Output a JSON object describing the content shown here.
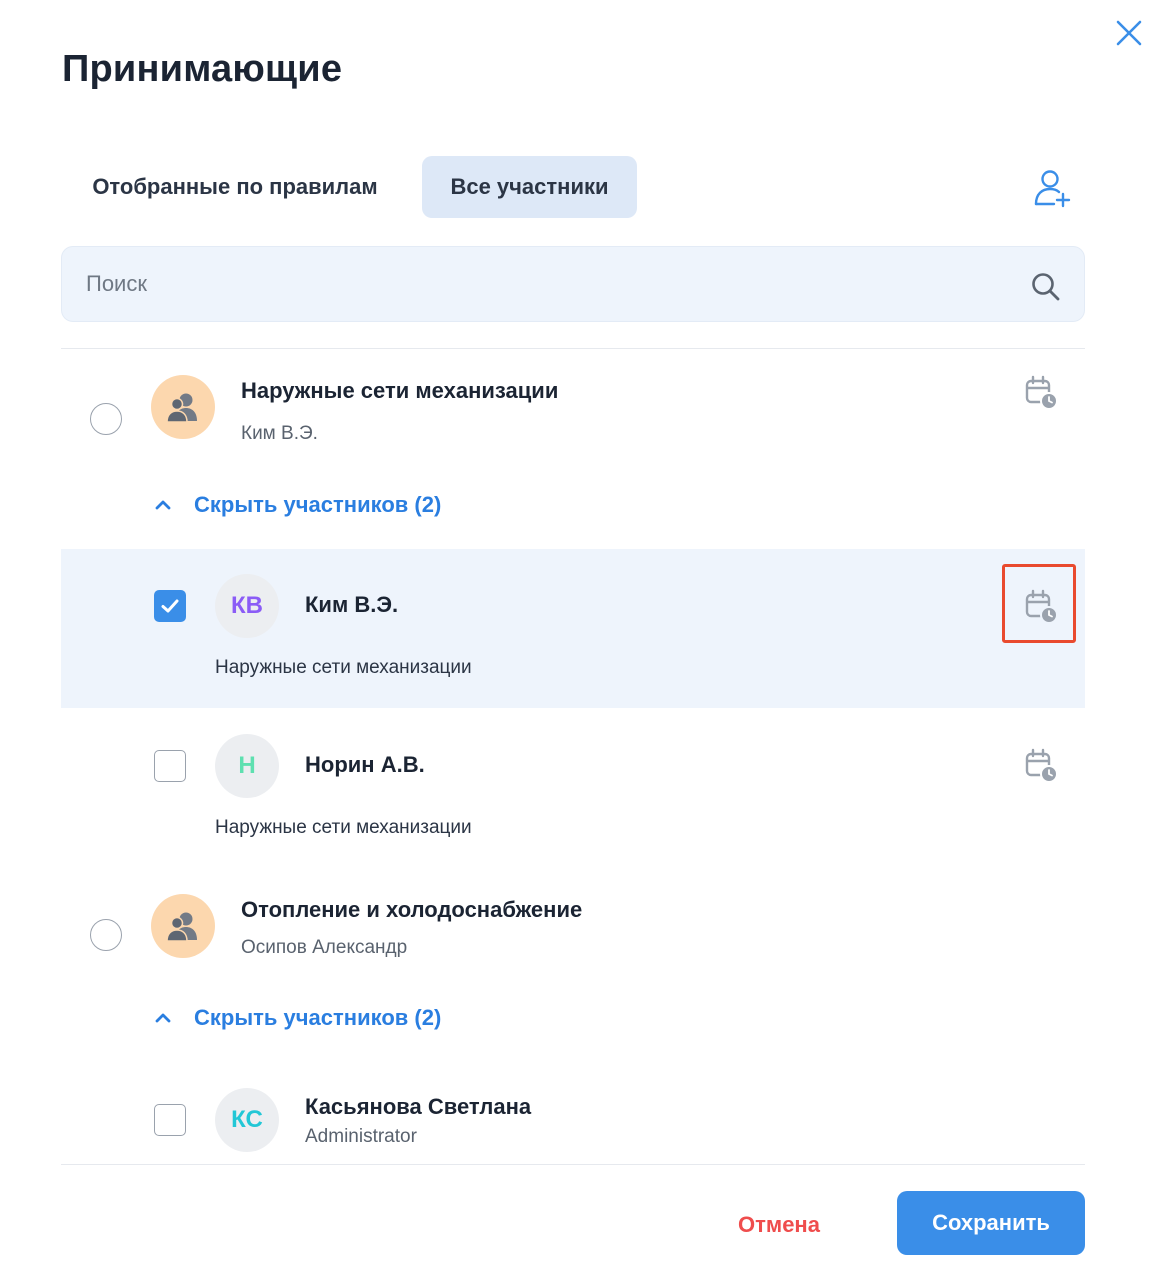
{
  "dialog": {
    "title": "Принимающие",
    "close_icon": "close-icon"
  },
  "tabs": [
    {
      "label": "Отобранные по правилам",
      "active": false
    },
    {
      "label": "Все участники",
      "active": true
    }
  ],
  "add_user_icon": "add-user-icon",
  "search": {
    "placeholder": "Поиск",
    "value": "",
    "icon": "search-icon"
  },
  "groups": [
    {
      "name": "Наружные сети механизации",
      "lead": "Ким В.Э.",
      "selected": false,
      "toggle_label": "Скрыть участников (2)",
      "members": [
        {
          "initials": "КВ",
          "initials_color": "#8b5cf6",
          "name": "Ким В.Э.",
          "sub": "Наружные сети механизации",
          "checked": true
        },
        {
          "initials": "Н",
          "initials_color": "#5ee0b0",
          "name": "Норин А.В.",
          "sub": "Наружные сети механизации",
          "checked": false
        }
      ]
    },
    {
      "name": "Отопление и холодоснабжение",
      "lead": "Осипов Александр",
      "selected": false,
      "toggle_label": "Скрыть участников (2)",
      "members": [
        {
          "initials": "КС",
          "initials_color": "#22c7d6",
          "name": "Касьянова Светлана",
          "sub": "Administrator",
          "checked": false
        }
      ]
    }
  ],
  "colors": {
    "accent": "#3a8ee8",
    "link": "#2a7ee0",
    "danger": "#ef4d4d",
    "selected_row": "#eef4fc",
    "group_avatar": "#fcd7ae",
    "highlight": "#e94a2e"
  },
  "footer": {
    "cancel_label": "Отмена",
    "save_label": "Сохранить"
  }
}
